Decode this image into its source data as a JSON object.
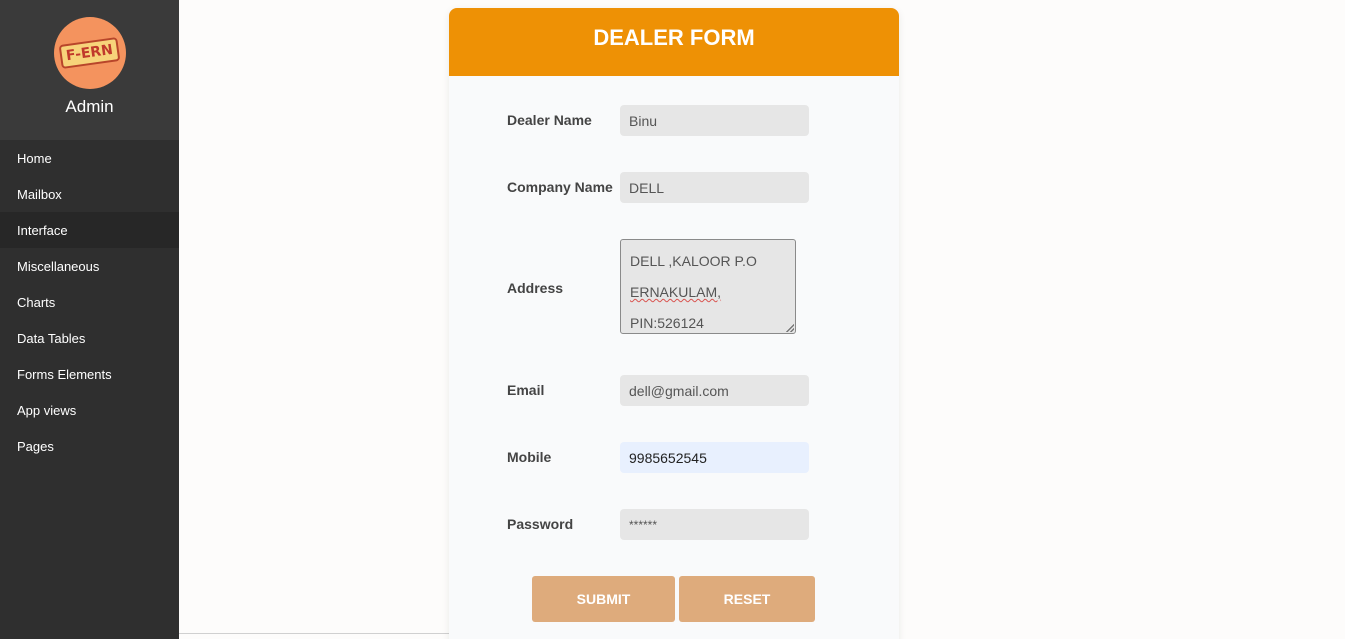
{
  "sidebar": {
    "logo_text": "F-ERN",
    "user_label": "Admin",
    "items": [
      {
        "label": "Home"
      },
      {
        "label": "Mailbox"
      },
      {
        "label": "Interface"
      },
      {
        "label": "Miscellaneous"
      },
      {
        "label": "Charts"
      },
      {
        "label": "Data Tables"
      },
      {
        "label": "Forms Elements"
      },
      {
        "label": "App views"
      },
      {
        "label": "Pages"
      }
    ],
    "active_item": "Interface"
  },
  "form": {
    "title": "DEALER FORM",
    "dealer_name": {
      "label": "Dealer Name",
      "value": "Binu"
    },
    "company_name": {
      "label": "Company Name",
      "value": "DELL"
    },
    "address": {
      "label": "Address",
      "lines": [
        "DELL ,KALOOR P.O",
        "ERNAKULAM,",
        "PIN:526124"
      ]
    },
    "email": {
      "label": "Email",
      "value": "dell@gmail.com"
    },
    "mobile": {
      "label": "Mobile",
      "value": "9985652545"
    },
    "password": {
      "label": "Password",
      "value": "******"
    },
    "submit_label": "SUBMIT",
    "reset_label": "RESET"
  },
  "colors": {
    "sidebar_bg": "#2f2f2f",
    "header_accent": "#ee9105",
    "button_bg": "#deab7c",
    "logo_bg": "#f4935e"
  }
}
